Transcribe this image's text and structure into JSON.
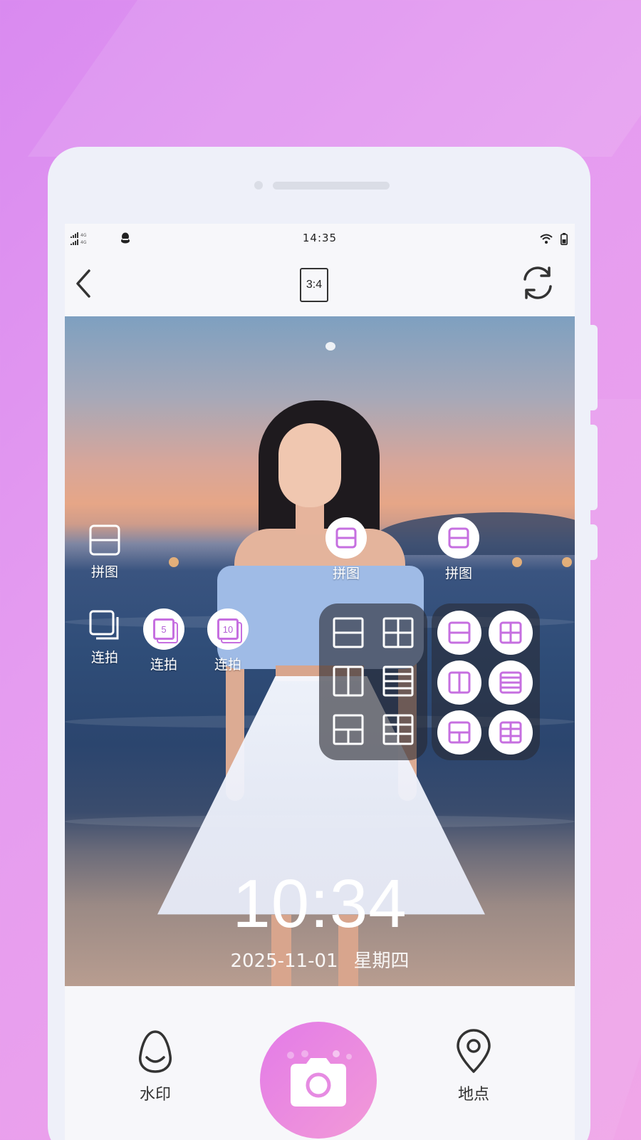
{
  "status_bar": {
    "time": "14:35",
    "network_top": "4G",
    "network_bottom": "4G"
  },
  "header": {
    "ratio_label": "3:4",
    "back_icon": "chevron-left-icon",
    "flip_icon": "camera-flip-icon"
  },
  "tools": {
    "collage_labels": [
      "拼图",
      "拼图",
      "拼图"
    ],
    "burst_labels": [
      "连拍",
      "连拍",
      "连拍"
    ],
    "burst_counts": [
      "5",
      "10"
    ]
  },
  "watermark": {
    "time": "10:34",
    "date": "2025-11-01",
    "weekday": "星期四"
  },
  "bottom_bar": {
    "watermark_label": "水印",
    "location_label": "地点",
    "shutter_icon": "camera-icon"
  },
  "colors": {
    "accent": "#c66fe0",
    "shutter_start": "#e37be8",
    "shutter_end": "#f29ad7",
    "page_bg": "#e59cf0"
  }
}
